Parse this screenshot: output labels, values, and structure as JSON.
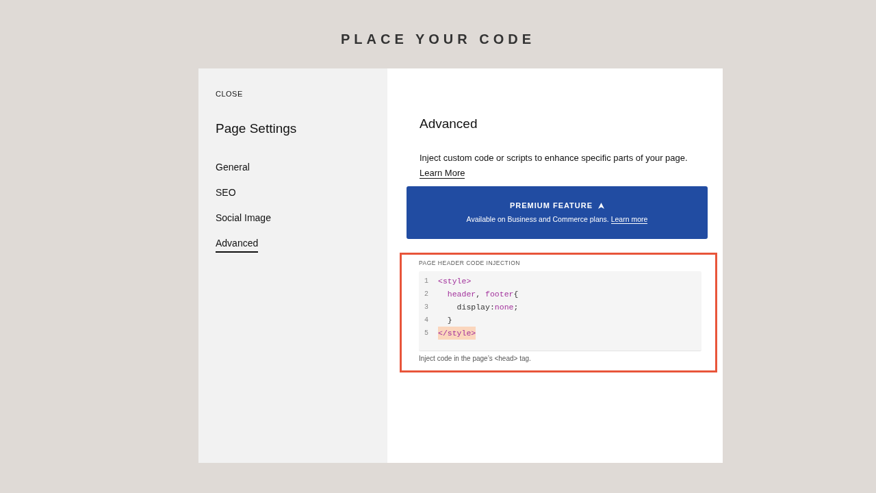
{
  "slide_title": "PLACE YOUR CODE",
  "sidebar": {
    "close": "CLOSE",
    "title": "Page Settings",
    "items": [
      {
        "label": "General",
        "selected": false
      },
      {
        "label": "SEO",
        "selected": false
      },
      {
        "label": "Social Image",
        "selected": false
      },
      {
        "label": "Advanced",
        "selected": true
      }
    ]
  },
  "main": {
    "title": "Advanced",
    "description": "Inject custom code or scripts to enhance specific parts of your page.",
    "learn_more": "Learn More",
    "premium": {
      "title": "PREMIUM FEATURE",
      "text": "Available on Business and Commerce plans.",
      "link": "Learn more"
    },
    "code_field": {
      "label": "PAGE HEADER CODE INJECTION",
      "lines": [
        {
          "number": "1",
          "highlighted": false,
          "tokens": [
            {
              "text": "<style>",
              "kind": "tag"
            }
          ]
        },
        {
          "number": "2",
          "highlighted": false,
          "tokens": [
            {
              "text": "  header",
              "kind": "keyword"
            },
            {
              "text": ", ",
              "kind": "plain"
            },
            {
              "text": "footer",
              "kind": "keyword"
            },
            {
              "text": "{",
              "kind": "plain"
            }
          ]
        },
        {
          "number": "3",
          "highlighted": false,
          "tokens": [
            {
              "text": "    display:",
              "kind": "plain"
            },
            {
              "text": "none",
              "kind": "keyword"
            },
            {
              "text": ";",
              "kind": "plain"
            }
          ]
        },
        {
          "number": "4",
          "highlighted": false,
          "tokens": [
            {
              "text": "  }",
              "kind": "plain"
            }
          ]
        },
        {
          "number": "5",
          "highlighted": true,
          "tokens": [
            {
              "text": "</style>",
              "kind": "tag"
            }
          ]
        }
      ],
      "help": "Inject code in the page’s <head> tag."
    }
  }
}
